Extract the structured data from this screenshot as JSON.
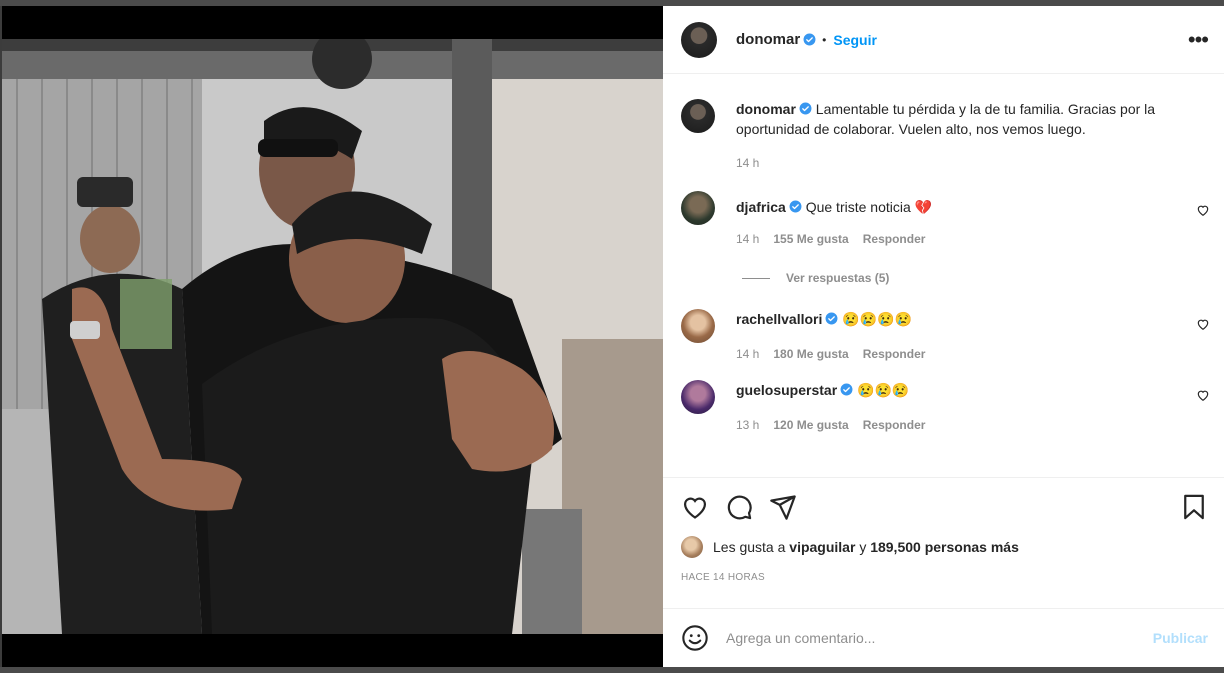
{
  "post": {
    "author": "donomar",
    "follow_label": "Seguir",
    "dot": "•",
    "more": "•••",
    "caption": {
      "user": "donomar",
      "text": "Lamentable tu pérdida y la de tu familia. Gracias por la oportunidad de colaborar. Vuelen alto, nos vemos luego.",
      "time": "14 h"
    }
  },
  "comments": [
    {
      "user": "djafrica",
      "text": "Que triste noticia 💔",
      "time": "14 h",
      "likes": "155 Me gusta",
      "reply": "Responder"
    },
    {
      "user": "rachellvallori",
      "text": "😢😢😢😢",
      "time": "14 h",
      "likes": "180 Me gusta",
      "reply": "Responder"
    },
    {
      "user": "guelosuperstar",
      "text": "😢😢😢",
      "time": "13 h",
      "likes": "120 Me gusta",
      "reply": "Responder"
    }
  ],
  "view_replies": "Ver respuestas (5)",
  "likes": {
    "prefix": "Les gusta a",
    "user": "vipaguilar",
    "joiner": "y",
    "rest": "189,500 personas más"
  },
  "timestamp": "HACE 14 HORAS",
  "add_comment": {
    "placeholder": "Agrega un comentario...",
    "publish": "Publicar"
  },
  "colors": {
    "accent": "#0095f6",
    "verified": "#3897f0",
    "publish_disabled": "#b2dffc"
  }
}
